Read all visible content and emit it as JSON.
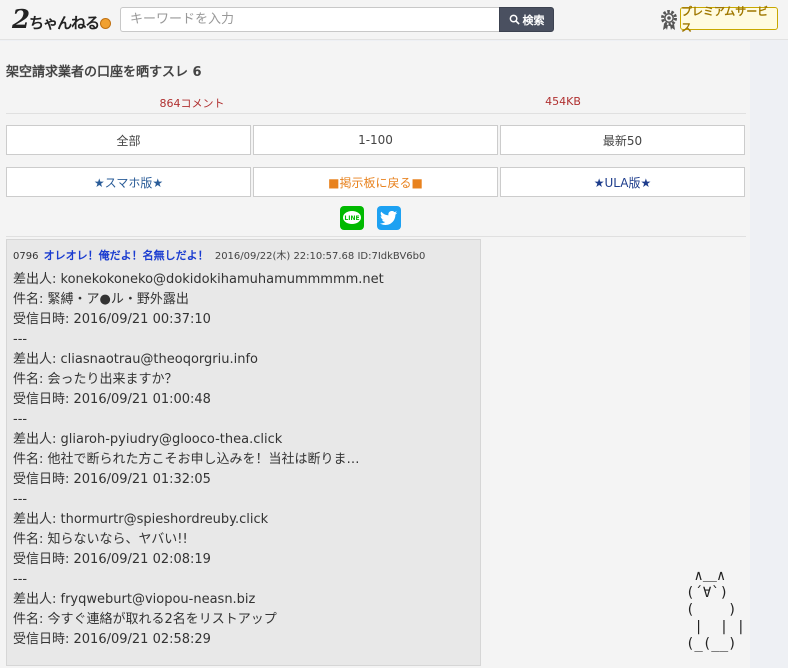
{
  "header": {
    "logo_main": "2",
    "logo_kana": "ちゃんねる",
    "search_placeholder": "キーワードを入力",
    "search_button": "検索",
    "premium_label": "プレミアムサービス"
  },
  "thread": {
    "title": "架空請求業者の口座を晒すスレ 6",
    "comments": "864コメント",
    "size": "454KB"
  },
  "nav": {
    "all": "全部",
    "range": "1-100",
    "latest": "最新50",
    "smartphone": "★スマホ版★",
    "back": "■掲示板に戻る■",
    "ula": "★ULA版★"
  },
  "post": {
    "number": "0796",
    "name": "オレオレ！俺だよ！名無しだよ！",
    "datetime": "2016/09/22(木) 22:10:57.68 ID:7IdkBV6b0",
    "lines": [
      "差出人: konekokoneko@dokidokihamuhamummmmm.net",
      "件名: 緊縛・ア●ル・野外露出",
      "受信日時: 2016/09/21 00:37:10",
      "---",
      "差出人: cliasnaotrau@theoqorgriu.info",
      "件名: 会ったり出来ますか？",
      "受信日時: 2016/09/21 01:00:48",
      "---",
      "差出人: gliaroh-pyiudry@glooco-thea.click",
      "件名: 他社で断られた方こそお申し込みを！当社は断りま…",
      "受信日時: 2016/09/21 01:32:05",
      "---",
      "差出人: thormurtr@spieshordreuby.click",
      "件名: 知らないなら、ヤバい!!",
      "受信日時: 2016/09/21 02:08:19",
      "---",
      "差出人: fryqweburt@viopou-neasn.biz",
      "件名: 今すぐ連絡が取れる2名をリストアップ",
      "受信日時: 2016/09/21 02:58:29"
    ]
  },
  "ascii_art": " ∧＿∧\n(´∀`)\n(    )\n |  | |\n(_(__)",
  "icons": [
    "search-icon",
    "gear-icon",
    "line-icon",
    "twitter-icon"
  ],
  "colors": {
    "comment_count": "#b03030",
    "post_name": "#1a3cd0",
    "back_link": "#e8821e",
    "line": "#00b900",
    "twitter": "#1da1f2"
  }
}
